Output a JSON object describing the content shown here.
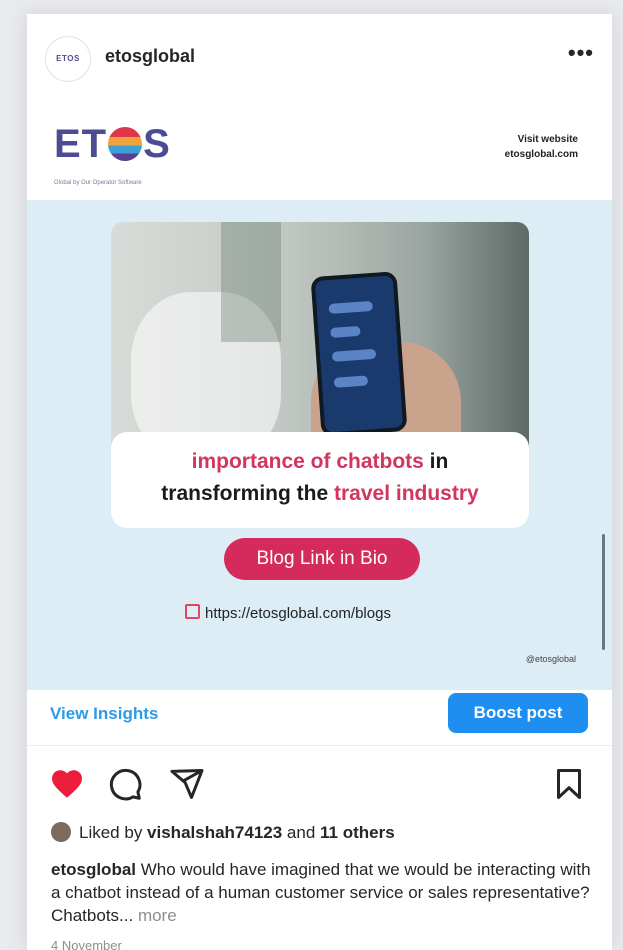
{
  "post": {
    "username": "etosglobal",
    "avatar_text": "ETOS",
    "more_label": "•••",
    "image": {
      "logo_prefix": "ET",
      "logo_suffix": "S",
      "logo_tagline": "Global by Our Operator Software",
      "visit_label": "Visit website",
      "visit_url": "etosglobal.com",
      "headline_part1": "importance of chatbots",
      "headline_part2": " in",
      "headline_part3": "transforming the ",
      "headline_part4": "travel industry",
      "cta_label": "Blog Link in Bio",
      "link_text": "https://etosglobal.com/blogs",
      "handle": "@etosglobal"
    },
    "insights_label": "View Insights",
    "boost_label": "Boost post",
    "actions": [
      "heart-icon",
      "comment-icon",
      "share-icon",
      "bookmark-icon"
    ],
    "likes": {
      "prefix": "Liked by ",
      "user": "vishalshah74123",
      "middle": " and ",
      "others": "11 others"
    },
    "caption": {
      "user": "etosglobal",
      "text": " Who would have imagined that we would be interacting with a chatbot instead of a human customer service or sales representative? Chatbots... ",
      "more": "more"
    },
    "date": "4 November"
  },
  "colors": {
    "accent": "#1e8ff0",
    "pink": "#d42a5c",
    "heart": "#ed1c3a",
    "link_blue": "#2f9ae6"
  }
}
